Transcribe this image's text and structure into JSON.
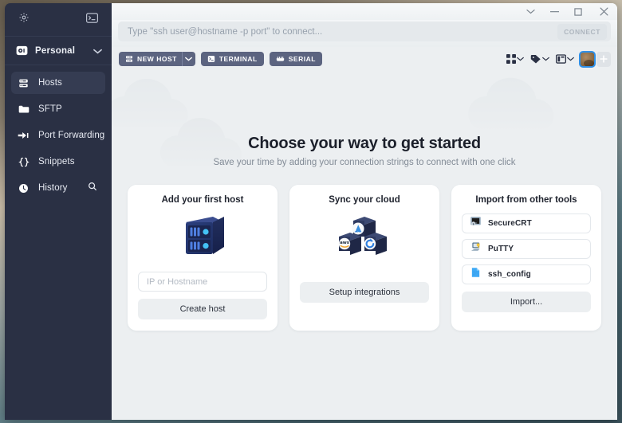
{
  "window": {
    "controls": [
      {
        "name": "chevron-down",
        "glyph": "∨"
      },
      {
        "name": "minimize",
        "glyph": "–"
      },
      {
        "name": "maximize",
        "glyph": "□"
      },
      {
        "name": "close",
        "glyph": "✕"
      }
    ]
  },
  "connect_bar": {
    "placeholder": "Type \"ssh user@hostname -p port\" to connect...",
    "value": "",
    "button_label": "CONNECT"
  },
  "sidebar": {
    "top_icons": [
      {
        "name": "gear-icon",
        "label": "Settings"
      },
      {
        "name": "terminal-icon",
        "label": "Terminal"
      }
    ],
    "vault": {
      "label": "Personal",
      "icon": "safe-icon",
      "chevron": "∨"
    },
    "items": [
      {
        "label": "Hosts",
        "icon": "server-icon",
        "active": true
      },
      {
        "label": "SFTP",
        "icon": "folder-icon",
        "active": false
      },
      {
        "label": "Port Forwarding",
        "icon": "port-forward-icon",
        "active": false
      },
      {
        "label": "Snippets",
        "icon": "braces-icon",
        "active": false
      },
      {
        "label": "History",
        "icon": "clock-icon",
        "active": false,
        "trailing_icon": "search-icon"
      }
    ]
  },
  "toolbar": {
    "new_host_label": "NEW HOST",
    "new_host_caret": "∨",
    "terminal_label": "TERMINAL",
    "serial_label": "SERIAL",
    "right_icons": [
      {
        "name": "grid-view-icon",
        "caret": "∨"
      },
      {
        "name": "tag-icon",
        "caret": "∨"
      },
      {
        "name": "layout-icon",
        "caret": "∨"
      }
    ],
    "avatar_name": "user-avatar",
    "add_label": "+"
  },
  "hero": {
    "title": "Choose your way to get started",
    "subtitle": "Save your time by adding your connection strings to connect with one click"
  },
  "cards": [
    {
      "title": "Add your first host",
      "art": "server-illustration",
      "input_placeholder": "IP or Hostname",
      "input_value": "",
      "button_label": "Create host"
    },
    {
      "title": "Sync your cloud",
      "art": "cloud-cubes-illustration",
      "cubes": [
        "azure",
        "aws",
        "gcp"
      ],
      "button_label": "Setup integrations"
    },
    {
      "title": "Import from other tools",
      "rows": [
        {
          "label": "SecureCRT",
          "icon": "securecrt-icon"
        },
        {
          "label": "PuTTY",
          "icon": "putty-icon"
        },
        {
          "label": "ssh_config",
          "icon": "file-icon"
        }
      ],
      "button_label": "Import..."
    }
  ],
  "colors": {
    "sidebar_bg": "#2a3044",
    "content_bg": "#eceff1",
    "toolbar_btn": "#5c6480",
    "accent_blue": "#2f90e8",
    "card_bg": "#ffffff",
    "title_text": "#1b1f2a",
    "muted_text": "#828b96"
  }
}
